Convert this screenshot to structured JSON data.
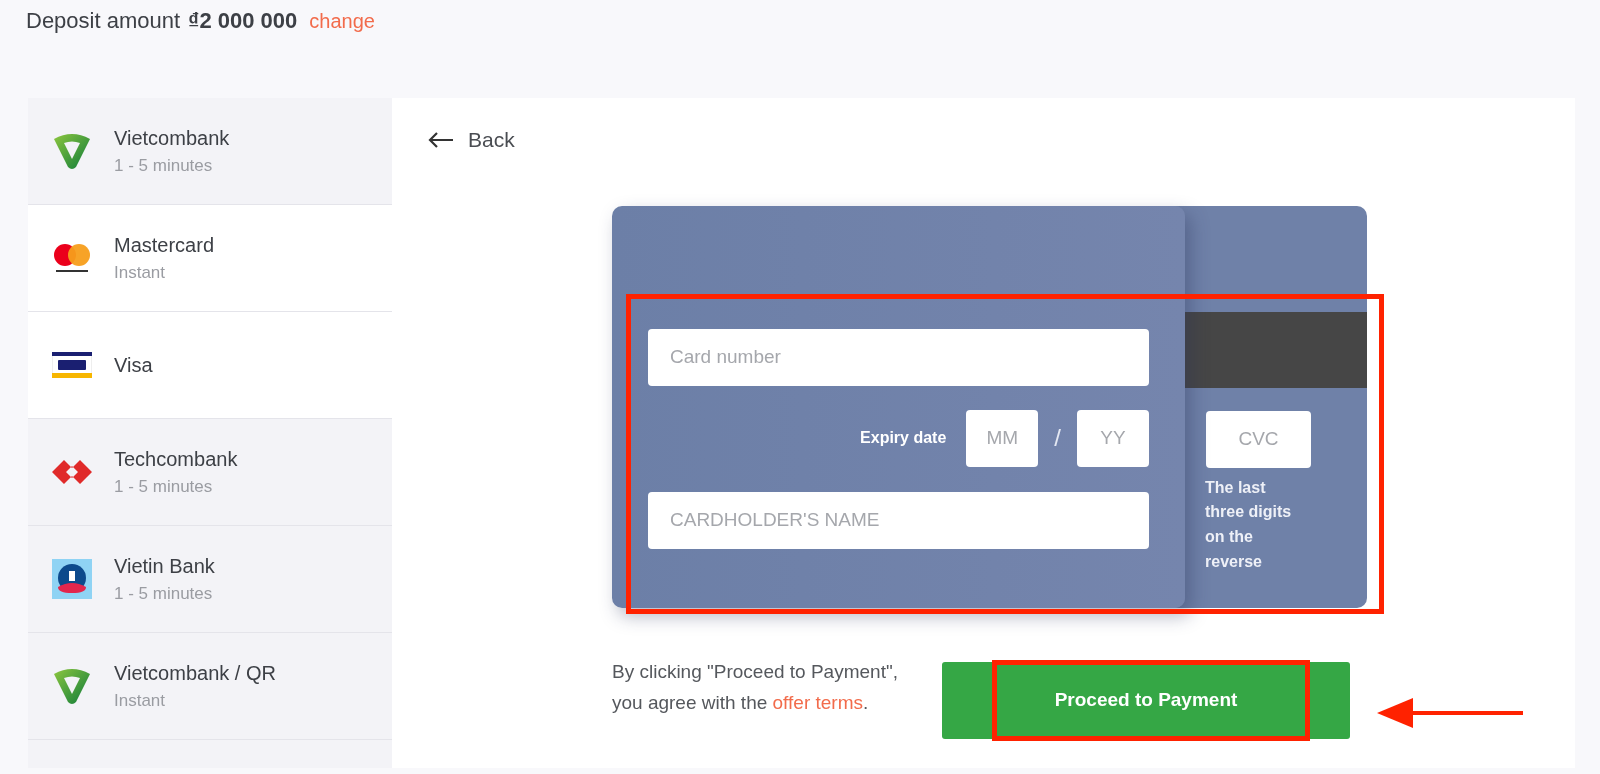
{
  "header": {
    "label": "Deposit amount",
    "amount": "₫2 000 000",
    "change_link": "change"
  },
  "methods": [
    {
      "name": "Vietcombank",
      "time": "1 - 5 minutes",
      "kind": "vietcombank",
      "selected": false
    },
    {
      "name": "Mastercard",
      "time": "Instant",
      "kind": "mastercard",
      "selected": true
    },
    {
      "name": "Visa",
      "kind": "visa",
      "selected": true
    },
    {
      "name": "Techcombank",
      "time": "1 - 5 minutes",
      "kind": "techcombank",
      "selected": false
    },
    {
      "name": "Vietin Bank",
      "time": "1 - 5 minutes",
      "kind": "vietinbank",
      "selected": false
    },
    {
      "name": "Vietcombank / QR",
      "time": "Instant",
      "kind": "vietcombank",
      "selected": false
    }
  ],
  "back": "Back",
  "card_form": {
    "highlighted": true,
    "card_number": {
      "placeholder": "Card number"
    },
    "expiry_label": "Expiry date",
    "month": {
      "placeholder": "MM"
    },
    "separator": "/",
    "year": {
      "placeholder": "YY"
    },
    "holder": {
      "placeholder": "CARDHOLDER'S NAME"
    },
    "cvc": {
      "placeholder": "CVC"
    },
    "cvc_hint": "The last three digits on the reverse"
  },
  "terms": {
    "text": "By clicking \"Proceed to Payment\", you agree with the",
    "link": "offer terms",
    "end": "."
  },
  "proceed_button": {
    "label": "Proceed to Payment",
    "highlighted": true,
    "pointed": true
  }
}
